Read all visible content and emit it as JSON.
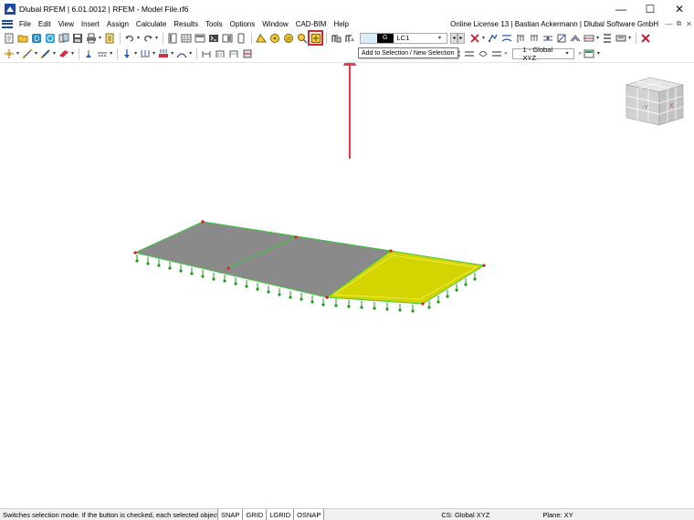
{
  "window": {
    "title": "Dlubal RFEM | 6.01.0012 | RFEM - Model File.rf6",
    "minimize": "—",
    "maximize": "☐",
    "close": "✕"
  },
  "menu": {
    "items": [
      "File",
      "Edit",
      "View",
      "Insert",
      "Assign",
      "Calculate",
      "Results",
      "Tools",
      "Options",
      "Window",
      "CAD-BIM",
      "Help"
    ],
    "license": "Online License 13 | Bastian Ackermann | Dlubal Software GmbH",
    "doc_controls": [
      "—",
      "⧉",
      "✕"
    ]
  },
  "toolbar": {
    "load_case_badge": "G",
    "load_case": "LC1",
    "view_option": "1 - Global XYZ"
  },
  "tooltip": {
    "text": "Add to Selection / New Selection"
  },
  "nav_cube": {
    "front_label": "-Y",
    "side_label": "X"
  },
  "status": {
    "message": "Switches selection mode. If the button is checked, each selected object i",
    "toggles": [
      "SNAP",
      "GRID",
      "LGRID",
      "OSNAP"
    ],
    "cs": "CS: Global XYZ",
    "plane": "Plane: XY"
  },
  "colors": {
    "highlight_outline": "#d9232e",
    "annotation_arrow": "#e0404a",
    "surface_gray": "#8a8a8a",
    "surface_selected": "#d4d400",
    "edge_green": "#3ec83e",
    "support_green": "#1f9b1f",
    "node_red": "#d02020"
  }
}
